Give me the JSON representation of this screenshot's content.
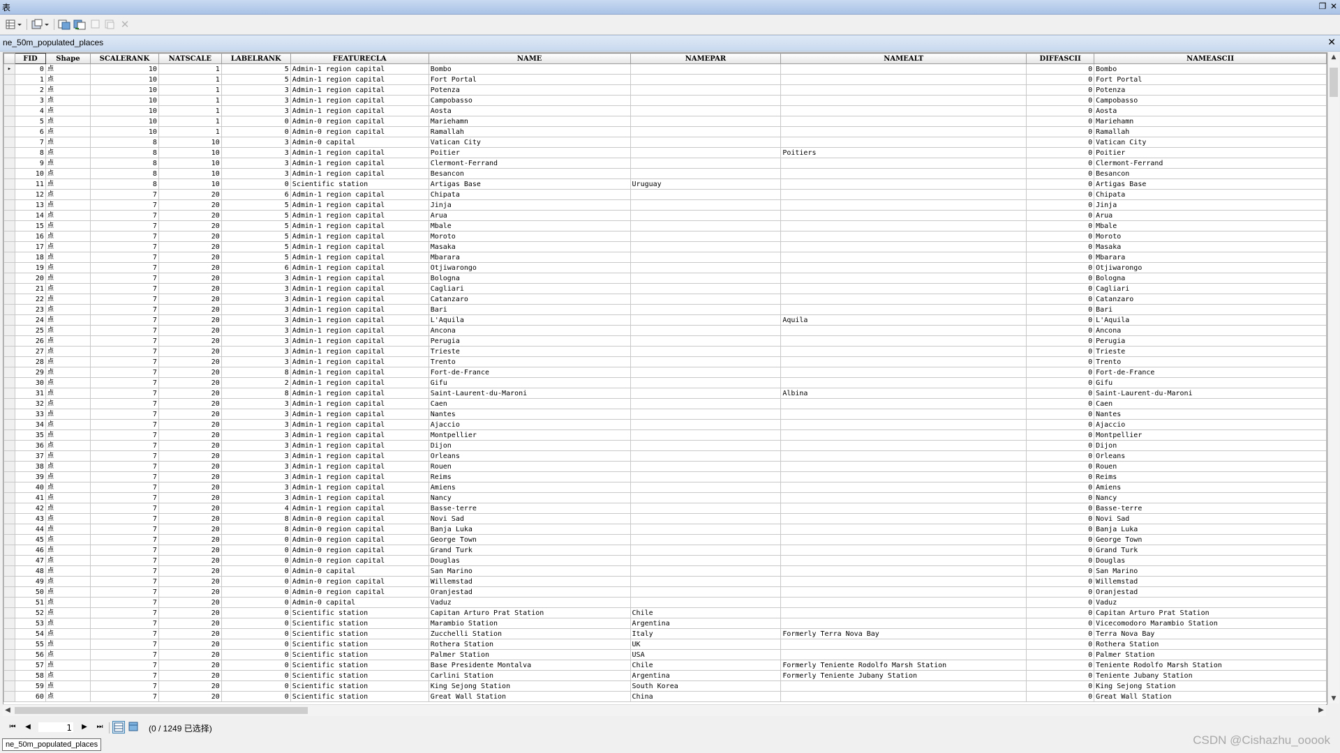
{
  "window": {
    "title": "表"
  },
  "tab": {
    "title": "ne_50m_populated_places"
  },
  "columns": [
    "FID",
    "Shape",
    "SCALERANK",
    "NATSCALE",
    "LABELRANK",
    "FEATURECLA",
    "NAME",
    "NAMEPAR",
    "NAMEALT",
    "DIFFASCII",
    "NAMEASCII"
  ],
  "rows": [
    [
      "0",
      "点",
      "10",
      "1",
      "5",
      "Admin-1 region capital",
      "Bombo",
      "",
      "",
      "0",
      "Bombo"
    ],
    [
      "1",
      "点",
      "10",
      "1",
      "5",
      "Admin-1 region capital",
      "Fort Portal",
      "",
      "",
      "0",
      "Fort Portal"
    ],
    [
      "2",
      "点",
      "10",
      "1",
      "3",
      "Admin-1 region capital",
      "Potenza",
      "",
      "",
      "0",
      "Potenza"
    ],
    [
      "3",
      "点",
      "10",
      "1",
      "3",
      "Admin-1 region capital",
      "Campobasso",
      "",
      "",
      "0",
      "Campobasso"
    ],
    [
      "4",
      "点",
      "10",
      "1",
      "3",
      "Admin-1 region capital",
      "Aosta",
      "",
      "",
      "0",
      "Aosta"
    ],
    [
      "5",
      "点",
      "10",
      "1",
      "0",
      "Admin-0 region capital",
      "Mariehamn",
      "",
      "",
      "0",
      "Mariehamn"
    ],
    [
      "6",
      "点",
      "10",
      "1",
      "0",
      "Admin-0 region capital",
      "Ramallah",
      "",
      "",
      "0",
      "Ramallah"
    ],
    [
      "7",
      "点",
      "8",
      "10",
      "3",
      "Admin-0 capital",
      "Vatican City",
      "",
      "",
      "0",
      "Vatican City"
    ],
    [
      "8",
      "点",
      "8",
      "10",
      "3",
      "Admin-1 region capital",
      "Poitier",
      "",
      "Poitiers",
      "0",
      "Poitier"
    ],
    [
      "9",
      "点",
      "8",
      "10",
      "3",
      "Admin-1 region capital",
      "Clermont-Ferrand",
      "",
      "",
      "0",
      "Clermont-Ferrand"
    ],
    [
      "10",
      "点",
      "8",
      "10",
      "3",
      "Admin-1 region capital",
      "Besancon",
      "",
      "",
      "0",
      "Besancon"
    ],
    [
      "11",
      "点",
      "8",
      "10",
      "0",
      "Scientific station",
      "Artigas Base",
      "Uruguay",
      "",
      "0",
      "Artigas Base"
    ],
    [
      "12",
      "点",
      "7",
      "20",
      "6",
      "Admin-1 region capital",
      "Chipata",
      "",
      "",
      "0",
      "Chipata"
    ],
    [
      "13",
      "点",
      "7",
      "20",
      "5",
      "Admin-1 region capital",
      "Jinja",
      "",
      "",
      "0",
      "Jinja"
    ],
    [
      "14",
      "点",
      "7",
      "20",
      "5",
      "Admin-1 region capital",
      "Arua",
      "",
      "",
      "0",
      "Arua"
    ],
    [
      "15",
      "点",
      "7",
      "20",
      "5",
      "Admin-1 region capital",
      "Mbale",
      "",
      "",
      "0",
      "Mbale"
    ],
    [
      "16",
      "点",
      "7",
      "20",
      "5",
      "Admin-1 region capital",
      "Moroto",
      "",
      "",
      "0",
      "Moroto"
    ],
    [
      "17",
      "点",
      "7",
      "20",
      "5",
      "Admin-1 region capital",
      "Masaka",
      "",
      "",
      "0",
      "Masaka"
    ],
    [
      "18",
      "点",
      "7",
      "20",
      "5",
      "Admin-1 region capital",
      "Mbarara",
      "",
      "",
      "0",
      "Mbarara"
    ],
    [
      "19",
      "点",
      "7",
      "20",
      "6",
      "Admin-1 region capital",
      "Otjiwarongo",
      "",
      "",
      "0",
      "Otjiwarongo"
    ],
    [
      "20",
      "点",
      "7",
      "20",
      "3",
      "Admin-1 region capital",
      "Bologna",
      "",
      "",
      "0",
      "Bologna"
    ],
    [
      "21",
      "点",
      "7",
      "20",
      "3",
      "Admin-1 region capital",
      "Cagliari",
      "",
      "",
      "0",
      "Cagliari"
    ],
    [
      "22",
      "点",
      "7",
      "20",
      "3",
      "Admin-1 region capital",
      "Catanzaro",
      "",
      "",
      "0",
      "Catanzaro"
    ],
    [
      "23",
      "点",
      "7",
      "20",
      "3",
      "Admin-1 region capital",
      "Bari",
      "",
      "",
      "0",
      "Bari"
    ],
    [
      "24",
      "点",
      "7",
      "20",
      "3",
      "Admin-1 region capital",
      "L'Aquila",
      "",
      "Aquila",
      "0",
      "L'Aquila"
    ],
    [
      "25",
      "点",
      "7",
      "20",
      "3",
      "Admin-1 region capital",
      "Ancona",
      "",
      "",
      "0",
      "Ancona"
    ],
    [
      "26",
      "点",
      "7",
      "20",
      "3",
      "Admin-1 region capital",
      "Perugia",
      "",
      "",
      "0",
      "Perugia"
    ],
    [
      "27",
      "点",
      "7",
      "20",
      "3",
      "Admin-1 region capital",
      "Trieste",
      "",
      "",
      "0",
      "Trieste"
    ],
    [
      "28",
      "点",
      "7",
      "20",
      "3",
      "Admin-1 region capital",
      "Trento",
      "",
      "",
      "0",
      "Trento"
    ],
    [
      "29",
      "点",
      "7",
      "20",
      "8",
      "Admin-1 region capital",
      "Fort-de-France",
      "",
      "",
      "0",
      "Fort-de-France"
    ],
    [
      "30",
      "点",
      "7",
      "20",
      "2",
      "Admin-1 region capital",
      "Gifu",
      "",
      "",
      "0",
      "Gifu"
    ],
    [
      "31",
      "点",
      "7",
      "20",
      "8",
      "Admin-1 region capital",
      "Saint-Laurent-du-Maroni",
      "",
      "Albina",
      "0",
      "Saint-Laurent-du-Maroni"
    ],
    [
      "32",
      "点",
      "7",
      "20",
      "3",
      "Admin-1 region capital",
      "Caen",
      "",
      "",
      "0",
      "Caen"
    ],
    [
      "33",
      "点",
      "7",
      "20",
      "3",
      "Admin-1 region capital",
      "Nantes",
      "",
      "",
      "0",
      "Nantes"
    ],
    [
      "34",
      "点",
      "7",
      "20",
      "3",
      "Admin-1 region capital",
      "Ajaccio",
      "",
      "",
      "0",
      "Ajaccio"
    ],
    [
      "35",
      "点",
      "7",
      "20",
      "3",
      "Admin-1 region capital",
      "Montpellier",
      "",
      "",
      "0",
      "Montpellier"
    ],
    [
      "36",
      "点",
      "7",
      "20",
      "3",
      "Admin-1 region capital",
      "Dijon",
      "",
      "",
      "0",
      "Dijon"
    ],
    [
      "37",
      "点",
      "7",
      "20",
      "3",
      "Admin-1 region capital",
      "Orleans",
      "",
      "",
      "0",
      "Orleans"
    ],
    [
      "38",
      "点",
      "7",
      "20",
      "3",
      "Admin-1 region capital",
      "Rouen",
      "",
      "",
      "0",
      "Rouen"
    ],
    [
      "39",
      "点",
      "7",
      "20",
      "3",
      "Admin-1 region capital",
      "Reims",
      "",
      "",
      "0",
      "Reims"
    ],
    [
      "40",
      "点",
      "7",
      "20",
      "3",
      "Admin-1 region capital",
      "Amiens",
      "",
      "",
      "0",
      "Amiens"
    ],
    [
      "41",
      "点",
      "7",
      "20",
      "3",
      "Admin-1 region capital",
      "Nancy",
      "",
      "",
      "0",
      "Nancy"
    ],
    [
      "42",
      "点",
      "7",
      "20",
      "4",
      "Admin-1 region capital",
      "Basse-terre",
      "",
      "",
      "0",
      "Basse-terre"
    ],
    [
      "43",
      "点",
      "7",
      "20",
      "8",
      "Admin-0 region capital",
      "Novi Sad",
      "",
      "",
      "0",
      "Novi Sad"
    ],
    [
      "44",
      "点",
      "7",
      "20",
      "8",
      "Admin-0 region capital",
      "Banja Luka",
      "",
      "",
      "0",
      "Banja Luka"
    ],
    [
      "45",
      "点",
      "7",
      "20",
      "0",
      "Admin-0 region capital",
      "George Town",
      "",
      "",
      "0",
      "George Town"
    ],
    [
      "46",
      "点",
      "7",
      "20",
      "0",
      "Admin-0 region capital",
      "Grand Turk",
      "",
      "",
      "0",
      "Grand Turk"
    ],
    [
      "47",
      "点",
      "7",
      "20",
      "0",
      "Admin-0 region capital",
      "Douglas",
      "",
      "",
      "0",
      "Douglas"
    ],
    [
      "48",
      "点",
      "7",
      "20",
      "0",
      "Admin-0 capital",
      "San Marino",
      "",
      "",
      "0",
      "San Marino"
    ],
    [
      "49",
      "点",
      "7",
      "20",
      "0",
      "Admin-0 region capital",
      "Willemstad",
      "",
      "",
      "0",
      "Willemstad"
    ],
    [
      "50",
      "点",
      "7",
      "20",
      "0",
      "Admin-0 region capital",
      "Oranjestad",
      "",
      "",
      "0",
      "Oranjestad"
    ],
    [
      "51",
      "点",
      "7",
      "20",
      "0",
      "Admin-0 capital",
      "Vaduz",
      "",
      "",
      "0",
      "Vaduz"
    ],
    [
      "52",
      "点",
      "7",
      "20",
      "0",
      "Scientific station",
      "Capitan Arturo Prat Station",
      "Chile",
      "",
      "0",
      "Capitan Arturo Prat Station"
    ],
    [
      "53",
      "点",
      "7",
      "20",
      "0",
      "Scientific station",
      "Marambio Station",
      "Argentina",
      "",
      "0",
      "Vicecomodoro Marambio Station"
    ],
    [
      "54",
      "点",
      "7",
      "20",
      "0",
      "Scientific station",
      "Zucchelli Station",
      "Italy",
      "Formerly Terra Nova Bay",
      "0",
      "Terra Nova Bay"
    ],
    [
      "55",
      "点",
      "7",
      "20",
      "0",
      "Scientific station",
      "Rothera Station",
      "UK",
      "",
      "0",
      "Rothera Station"
    ],
    [
      "56",
      "点",
      "7",
      "20",
      "0",
      "Scientific station",
      "Palmer Station",
      "USA",
      "",
      "0",
      "Palmer Station"
    ],
    [
      "57",
      "点",
      "7",
      "20",
      "0",
      "Scientific station",
      "Base Presidente Montalva",
      "Chile",
      "Formerly Teniente Rodolfo Marsh Station",
      "0",
      "Teniente Rodolfo Marsh Station"
    ],
    [
      "58",
      "点",
      "7",
      "20",
      "0",
      "Scientific station",
      "Carlini Station",
      "Argentina",
      "Formerly Teniente Jubany Station",
      "0",
      "Teniente Jubany Station"
    ],
    [
      "59",
      "点",
      "7",
      "20",
      "0",
      "Scientific station",
      "King Sejong Station",
      "South Korea",
      "",
      "0",
      "King Sejong Station"
    ],
    [
      "60",
      "点",
      "7",
      "20",
      "0",
      "Scientific station",
      "Great Wall Station",
      "China",
      "",
      "0",
      "Great Wall Station"
    ]
  ],
  "navigation": {
    "current_page": "1",
    "selection_status": "(0 / 1249 已选择)"
  },
  "bottom_tab": {
    "label": "ne_50m_populated_places"
  },
  "watermark": "CSDN @Cishazhu_ooook"
}
